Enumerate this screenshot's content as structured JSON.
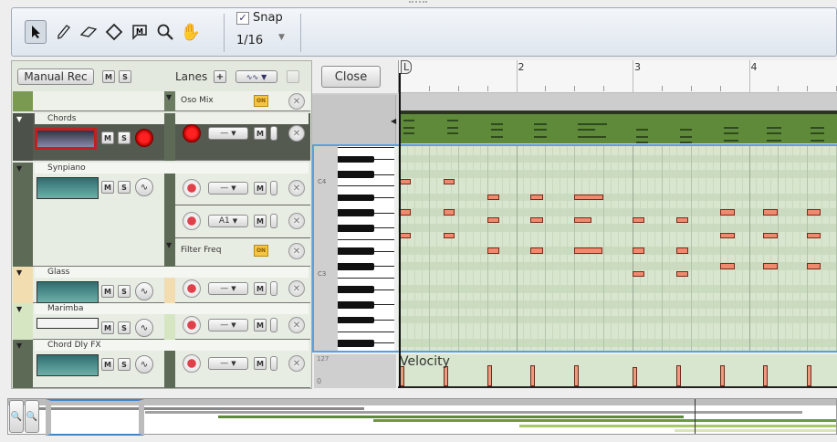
{
  "toolbar": {
    "tools": [
      "select-tool",
      "pencil-tool",
      "eraser-tool",
      "line-tool",
      "mute-tool",
      "magnify-tool",
      "hand-tool"
    ],
    "selected_tool": "select-tool",
    "snap_label": "Snap",
    "snap_checked": true,
    "snap_value": "1/16"
  },
  "track_header": {
    "manual_rec": "Manual Rec",
    "m": "M",
    "s": "S",
    "lanes": "Lanes",
    "lanes_add": "+",
    "close": "Close"
  },
  "top_lane": {
    "name": "Oso Mix",
    "on": "ON"
  },
  "tracks": [
    {
      "name": "Chords",
      "color": "#4c5249",
      "selected": true,
      "lanes": [
        {
          "type": "note",
          "dropdown": "—"
        }
      ]
    },
    {
      "name": "Synpiano",
      "color": "#5d6a56",
      "lanes": [
        {
          "type": "note",
          "dropdown": "—"
        },
        {
          "type": "note",
          "dropdown": "A1"
        },
        {
          "type": "auto",
          "name": "Filter Freq",
          "on": "ON"
        }
      ]
    },
    {
      "name": "Glass",
      "color": "#f2ddb0",
      "lanes": [
        {
          "type": "note",
          "dropdown": "—"
        }
      ]
    },
    {
      "name": "Marimba",
      "color": "#d6e6c2",
      "lanes": [
        {
          "type": "note",
          "dropdown": "—"
        }
      ]
    },
    {
      "name": "Chord Dly FX",
      "color": "#5d6a56",
      "lanes": [
        {
          "type": "note",
          "dropdown": "—"
        }
      ]
    }
  ],
  "ruler": {
    "bars": [
      "2",
      "3",
      "4"
    ],
    "locator": "L"
  },
  "keyboard": {
    "labels": [
      {
        "text": "C4",
        "pitch": 60
      },
      {
        "text": "C3",
        "pitch": 48
      }
    ]
  },
  "velocity": {
    "label": "Velocity",
    "max": "127",
    "min": "0"
  },
  "colors": {
    "note": "#ef8a6e",
    "clip": "#5e8a3a",
    "selection": "#5aa0e0"
  },
  "notes": [
    {
      "start": 0,
      "len": 1.5,
      "pitch": 60,
      "vel": 100
    },
    {
      "start": 0,
      "len": 1.5,
      "pitch": 56,
      "vel": 100
    },
    {
      "start": 0,
      "len": 1.5,
      "pitch": 53,
      "vel": 100
    },
    {
      "start": 6,
      "len": 1.5,
      "pitch": 60,
      "vel": 100
    },
    {
      "start": 6,
      "len": 1.5,
      "pitch": 56,
      "vel": 100
    },
    {
      "start": 6,
      "len": 1.5,
      "pitch": 53,
      "vel": 100
    },
    {
      "start": 12,
      "len": 1.7,
      "pitch": 58,
      "vel": 105
    },
    {
      "start": 12,
      "len": 1.7,
      "pitch": 55,
      "vel": 105
    },
    {
      "start": 12,
      "len": 1.7,
      "pitch": 51,
      "vel": 105
    },
    {
      "start": 18,
      "len": 1.7,
      "pitch": 58,
      "vel": 105
    },
    {
      "start": 18,
      "len": 1.7,
      "pitch": 55,
      "vel": 105
    },
    {
      "start": 18,
      "len": 1.7,
      "pitch": 51,
      "vel": 105
    },
    {
      "start": 24,
      "len": 4,
      "pitch": 58,
      "vel": 105
    },
    {
      "start": 24,
      "len": 2.3,
      "pitch": 55,
      "vel": 105
    },
    {
      "start": 24,
      "len": 3.8,
      "pitch": 51,
      "vel": 105
    },
    {
      "start": 32,
      "len": 1.6,
      "pitch": 55,
      "vel": 95
    },
    {
      "start": 32,
      "len": 1.6,
      "pitch": 51,
      "vel": 95
    },
    {
      "start": 32,
      "len": 1.6,
      "pitch": 48,
      "vel": 95
    },
    {
      "start": 38,
      "len": 1.6,
      "pitch": 55,
      "vel": 105
    },
    {
      "start": 38,
      "len": 1.6,
      "pitch": 51,
      "vel": 105
    },
    {
      "start": 38,
      "len": 1.6,
      "pitch": 48,
      "vel": 105
    },
    {
      "start": 44,
      "len": 2,
      "pitch": 56,
      "vel": 105
    },
    {
      "start": 44,
      "len": 2,
      "pitch": 53,
      "vel": 105
    },
    {
      "start": 44,
      "len": 2,
      "pitch": 49,
      "vel": 105
    },
    {
      "start": 50,
      "len": 2,
      "pitch": 56,
      "vel": 105
    },
    {
      "start": 50,
      "len": 2,
      "pitch": 53,
      "vel": 105
    },
    {
      "start": 50,
      "len": 2,
      "pitch": 49,
      "vel": 105
    },
    {
      "start": 56,
      "len": 1.8,
      "pitch": 56,
      "vel": 105
    },
    {
      "start": 56,
      "len": 1.8,
      "pitch": 53,
      "vel": 105
    },
    {
      "start": 56,
      "len": 1.8,
      "pitch": 49,
      "vel": 105
    }
  ]
}
